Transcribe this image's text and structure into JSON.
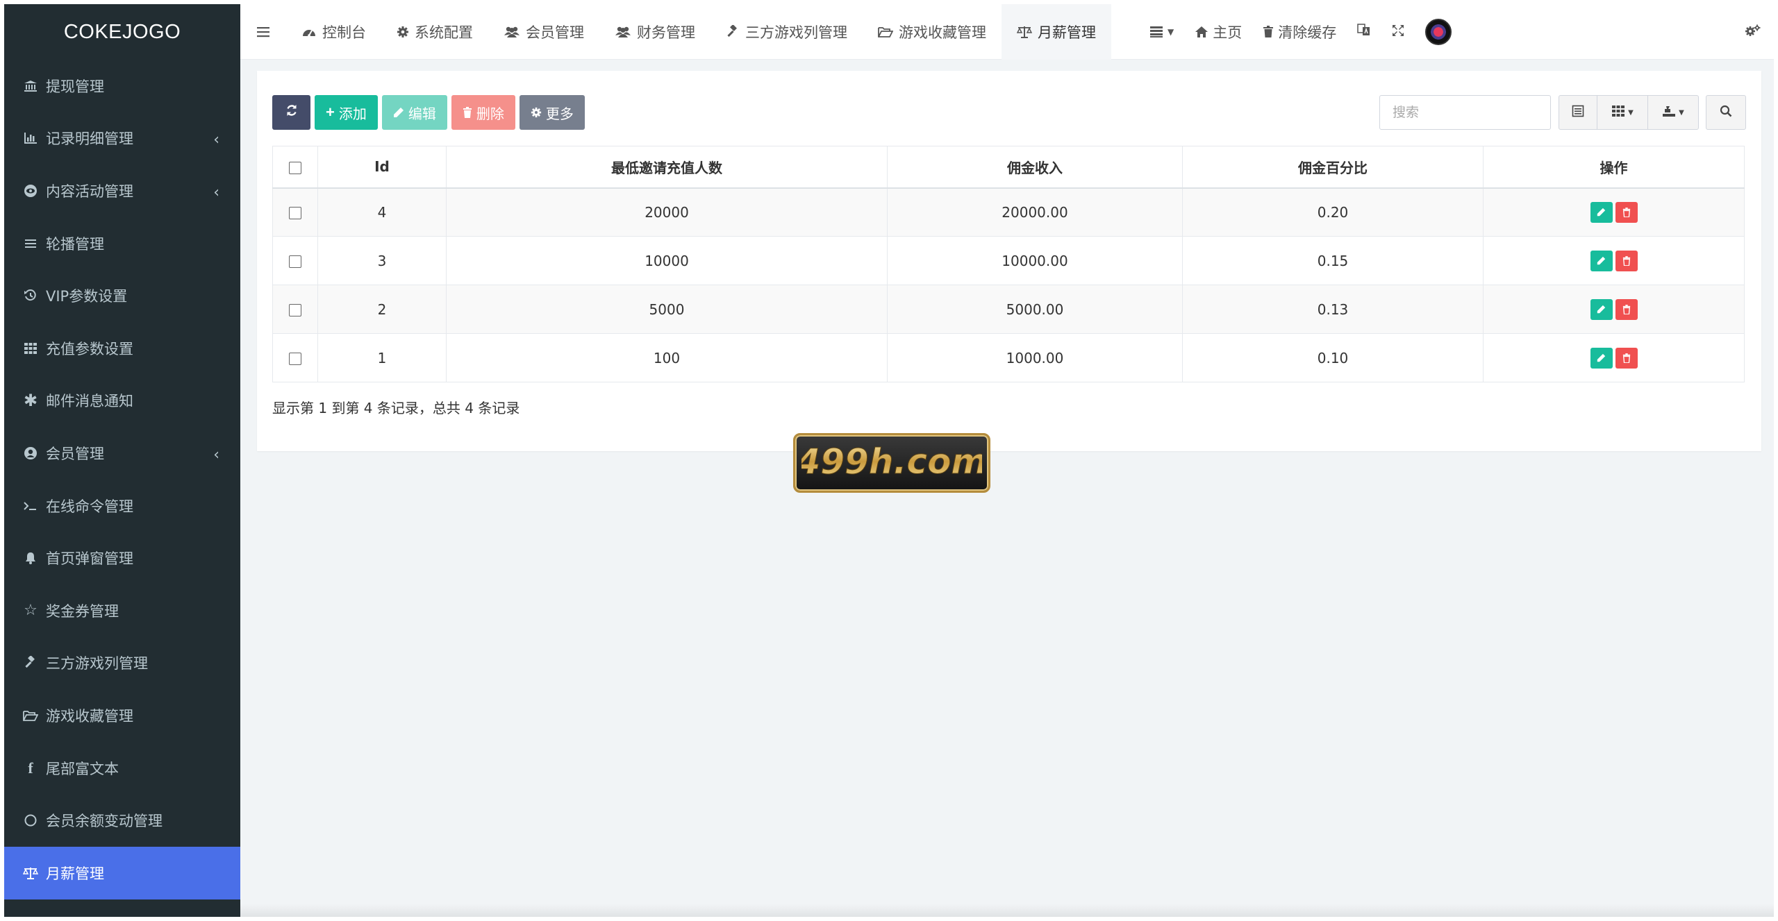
{
  "sidebar": {
    "brand": "COKEJOGO",
    "items": [
      {
        "label": "提现管理",
        "icon": "bank-icon",
        "expandable": false
      },
      {
        "label": "记录明细管理",
        "icon": "bar-chart-icon",
        "expandable": true
      },
      {
        "label": "内容活动管理",
        "icon": "eye-circle-icon",
        "expandable": true
      },
      {
        "label": "轮播管理",
        "icon": "list-icon",
        "expandable": false
      },
      {
        "label": "VIP参数设置",
        "icon": "history-icon",
        "expandable": false
      },
      {
        "label": "充值参数设置",
        "icon": "grid-icon",
        "expandable": false
      },
      {
        "label": "邮件消息通知",
        "icon": "asterisk-icon",
        "expandable": false
      },
      {
        "label": "会员管理",
        "icon": "user-circle-icon",
        "expandable": true
      },
      {
        "label": "在线命令管理",
        "icon": "terminal-icon",
        "expandable": false
      },
      {
        "label": "首页弹窗管理",
        "icon": "bell-icon",
        "expandable": false
      },
      {
        "label": "奖金券管理",
        "icon": "star-icon",
        "expandable": false
      },
      {
        "label": "三方游戏列管理",
        "icon": "gavel-icon",
        "expandable": false
      },
      {
        "label": "游戏收藏管理",
        "icon": "folder-open-icon",
        "expandable": false
      },
      {
        "label": "尾部富文本",
        "icon": "facebook-icon",
        "expandable": false
      },
      {
        "label": "会员余额变动管理",
        "icon": "circle-icon",
        "expandable": false
      },
      {
        "label": "月薪管理",
        "icon": "balance-scale-icon",
        "expandable": false,
        "active": true
      }
    ]
  },
  "topbar": {
    "tabs": [
      {
        "label": "控制台",
        "icon": "dashboard-icon"
      },
      {
        "label": "系统配置",
        "icon": "cog-icon"
      },
      {
        "label": "会员管理",
        "icon": "users-icon"
      },
      {
        "label": "财务管理",
        "icon": "users-icon"
      },
      {
        "label": "三方游戏列管理",
        "icon": "gavel-icon"
      },
      {
        "label": "游戏收藏管理",
        "icon": "folder-open-icon"
      },
      {
        "label": "月薪管理",
        "icon": "balance-scale-icon",
        "active": true
      }
    ],
    "tools": {
      "home": "主页",
      "clear_cache": "清除缓存"
    }
  },
  "toolbar": {
    "add": "添加",
    "edit": "编辑",
    "delete": "删除",
    "more": "更多",
    "search_placeholder": "搜索"
  },
  "table": {
    "headers": [
      "Id",
      "最低邀请充值人数",
      "佣金收入",
      "佣金百分比",
      "操作"
    ],
    "rows": [
      {
        "id": "4",
        "min_invite": "20000",
        "income": "20000.00",
        "percent": "0.20"
      },
      {
        "id": "3",
        "min_invite": "10000",
        "income": "10000.00",
        "percent": "0.15"
      },
      {
        "id": "2",
        "min_invite": "5000",
        "income": "5000.00",
        "percent": "0.13"
      },
      {
        "id": "1",
        "min_invite": "100",
        "income": "1000.00",
        "percent": "0.10"
      }
    ]
  },
  "pager": {
    "info": "显示第 1 到第 4 条记录，总共 4 条记录"
  },
  "watermark": {
    "text": "499h.com"
  },
  "colors": {
    "sidebar_bg": "#222d32",
    "sidebar_active": "#4a6fe8",
    "success": "#18bc9c",
    "danger": "#f05050",
    "primary_dark": "#444c69"
  }
}
